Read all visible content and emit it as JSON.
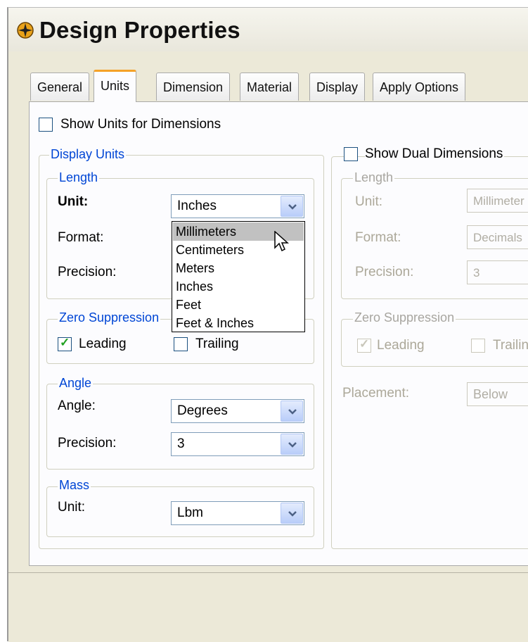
{
  "window": {
    "title": "Design Properties"
  },
  "tabs": [
    "General",
    "Units",
    "Dimension",
    "Material",
    "Display",
    "Apply Options"
  ],
  "active_tab": "Units",
  "show_units_for_dimensions": {
    "label": "Show Units for Dimensions",
    "checked": false
  },
  "display_units": {
    "title": "Display Units",
    "length": {
      "title": "Length",
      "unit_label": "Unit:",
      "unit_value": "Inches",
      "format_label": "Format:",
      "precision_label": "Precision:",
      "unit_options": [
        "Millimeters",
        "Centimeters",
        "Meters",
        "Inches",
        "Feet",
        "Feet & Inches"
      ],
      "highlighted_option": "Millimeters"
    },
    "zero_suppression": {
      "title": "Zero Suppression",
      "leading": {
        "label": "Leading",
        "checked": true
      },
      "trailing": {
        "label": "Trailing",
        "checked": false
      }
    },
    "angle": {
      "title": "Angle",
      "angle_label": "Angle:",
      "angle_value": "Degrees",
      "precision_label": "Precision:",
      "precision_value": "3"
    },
    "mass": {
      "title": "Mass",
      "unit_label": "Unit:",
      "unit_value": "Lbm"
    }
  },
  "dual": {
    "show_dual_label": "Show Dual Dimensions",
    "checked": false,
    "length": {
      "title": "Length",
      "unit_label": "Unit:",
      "unit_value": "Millimeter",
      "format_label": "Format:",
      "format_value": "Decimals",
      "precision_label": "Precision:",
      "precision_value": "3"
    },
    "zero_suppression": {
      "title": "Zero Suppression",
      "leading": {
        "label": "Leading",
        "checked": true
      },
      "trailing": {
        "label": "Trailin",
        "checked": false
      }
    },
    "placement_label": "Placement:",
    "placement_value": "Below"
  },
  "colors": {
    "group_title": "#0046d5",
    "active_tab_accent": "#f5a227",
    "check": "#21a121"
  }
}
